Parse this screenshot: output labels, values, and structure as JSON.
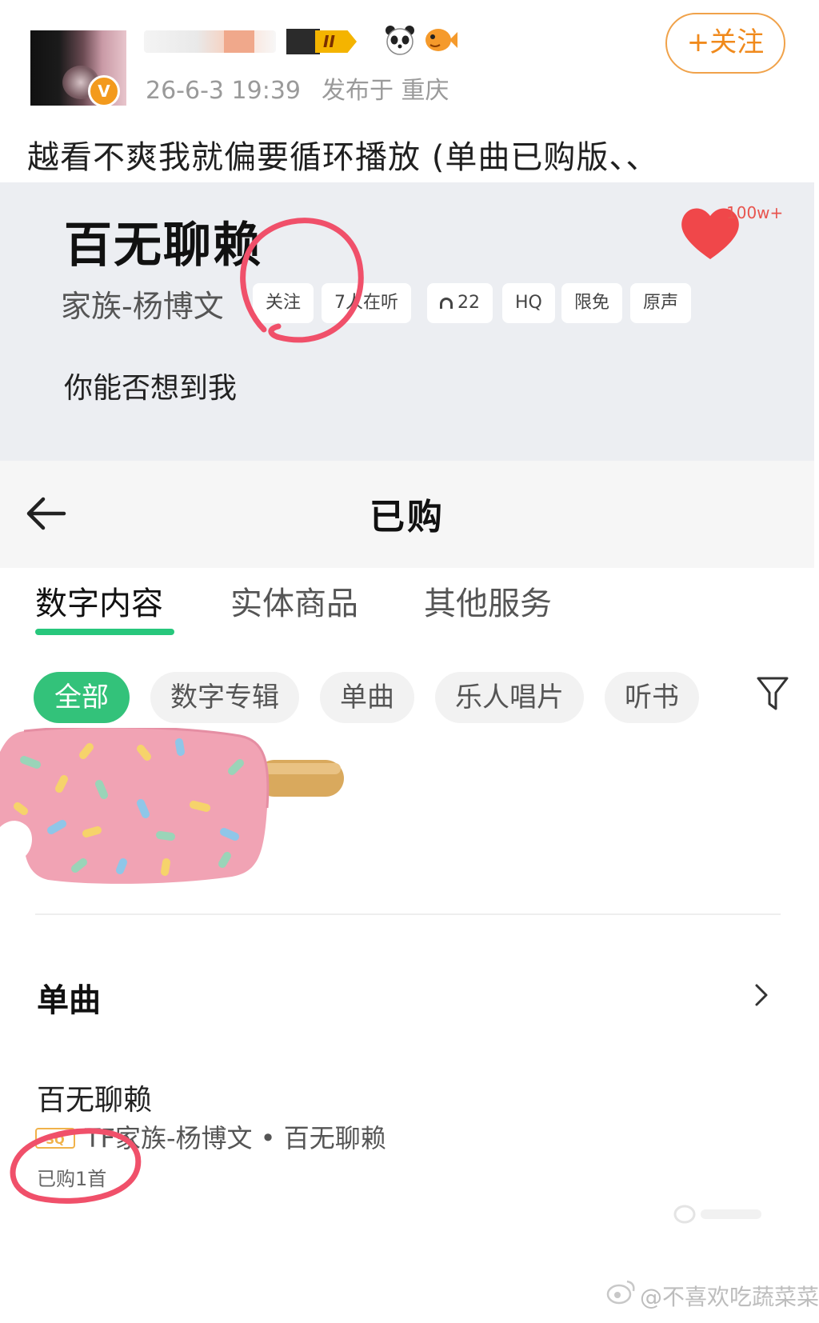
{
  "post": {
    "timestamp": "26-6-3 19:39",
    "location": "发布于 重庆",
    "follow_label": "+关注",
    "level_label": "II",
    "text": "越看不爽我就偏要循环播放 (单曲已购版、、"
  },
  "song_card": {
    "title": "百无聊赖",
    "artist": "家族-杨博文",
    "tags": [
      "关注",
      "7人在听",
      "22",
      "HQ",
      "限免",
      "原声"
    ],
    "like_count": "100w+",
    "lyric": "你能否想到我"
  },
  "purchased_page": {
    "title": "已购",
    "tabs": [
      {
        "label": "数字内容",
        "active": true
      },
      {
        "label": "实体商品",
        "active": false
      },
      {
        "label": "其他服务",
        "active": false
      }
    ],
    "filters": [
      {
        "label": "全部",
        "active": true
      },
      {
        "label": "数字专辑",
        "active": false
      },
      {
        "label": "单曲",
        "active": false
      },
      {
        "label": "乐人唱片",
        "active": false
      },
      {
        "label": "听书",
        "active": false
      }
    ],
    "section_title": "单曲",
    "item": {
      "title": "百无聊赖",
      "badge": "SQ",
      "subtitle": "TF家族-杨博文 • 百无聊赖",
      "count": "已购1首"
    }
  },
  "watermark": "@不喜欢吃蔬菜菜",
  "colors": {
    "accent_green": "#33c27a",
    "follow_orange": "#f08a1c",
    "heart_red": "#f0474a",
    "annotation_red": "#f0506a",
    "card_bg": "#eceef2"
  },
  "icons": [
    "verified-icon",
    "panda-icon",
    "fish-icon",
    "heart-icon",
    "back-arrow-icon",
    "filter-icon",
    "chevron-right-icon",
    "weibo-logo-icon"
  ]
}
